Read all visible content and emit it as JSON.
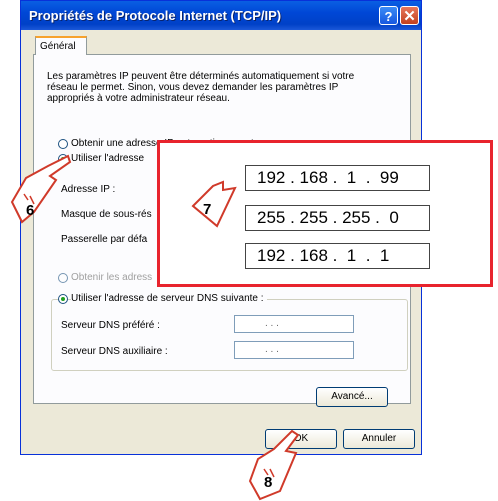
{
  "window": {
    "title": "Propriétés de Protocole Internet (TCP/IP)",
    "help_label": "?",
    "close_label": "✕"
  },
  "tab": {
    "label": "Général"
  },
  "description": "Les paramètres IP peuvent être déterminés automatiquement si votre réseau le permet. Sinon, vous devez demander les paramètres IP appropriés à votre administrateur réseau.",
  "ip_section": {
    "auto_label": "Obtenir une adresse IP automatiquement",
    "manual_label": "Utiliser l'adresse",
    "ip_label": "Adresse IP :",
    "mask_label": "Masque de sous-rés",
    "gateway_label": "Passerelle par défa"
  },
  "dns_section": {
    "auto_label": "Obtenir les adress",
    "manual_label": "Utiliser l'adresse de serveur DNS suivante :",
    "preferred_label": "Serveur DNS préféré :",
    "alternate_label": "Serveur DNS auxiliaire :",
    "empty_ip": ".     .     ."
  },
  "buttons": {
    "advanced": "Avancé...",
    "ok": "OK",
    "cancel": "Annuler"
  },
  "zoom": {
    "ip_address": "192 . 168 .  1  .  99",
    "subnet_mask": "255 . 255 . 255 .  0",
    "gateway": "192 . 168 .  1  .  1"
  },
  "steps": {
    "six": "6",
    "seven": "7",
    "eight": "8"
  },
  "colors": {
    "highlight": "#e8232d",
    "title_bar": "#0047d6",
    "badge_stroke": "#d03a2a"
  }
}
